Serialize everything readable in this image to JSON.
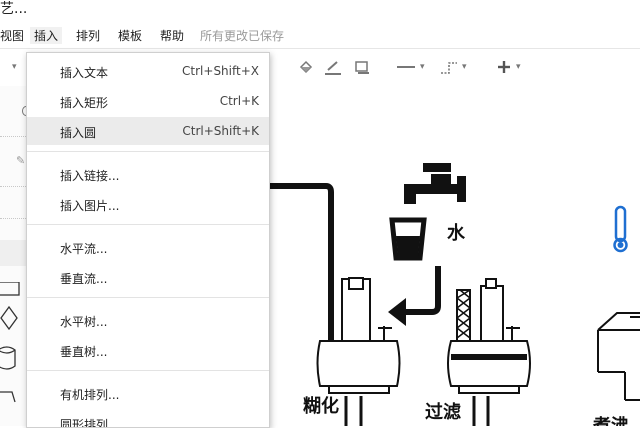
{
  "window": {
    "title": "艺..."
  },
  "menubar": {
    "items": [
      {
        "label": "视图"
      },
      {
        "label": "插入"
      },
      {
        "label": "排列"
      },
      {
        "label": "模板"
      },
      {
        "label": "帮助"
      }
    ],
    "save_status": "所有更改已保存"
  },
  "insert_menu": {
    "items": [
      {
        "label": "插入文本",
        "shortcut": "Ctrl+Shift+X"
      },
      {
        "label": "插入矩形",
        "shortcut": "Ctrl+K"
      },
      {
        "label": "插入圆",
        "shortcut": "Ctrl+Shift+K",
        "highlighted": true
      },
      {
        "label": "插入链接..."
      },
      {
        "label": "插入图片..."
      },
      {
        "label": "水平流..."
      },
      {
        "label": "垂直流..."
      },
      {
        "label": "水平树..."
      },
      {
        "label": "垂直树..."
      },
      {
        "label": "有机排列..."
      },
      {
        "label": "圆形排列"
      }
    ]
  },
  "toolbar": {
    "icons": [
      "chevron-down-icon",
      "fill-color-icon",
      "line-color-icon",
      "shadow-icon",
      "line-style-icon",
      "connector-waypoint-icon",
      "insert-plus-icon"
    ]
  },
  "canvas": {
    "labels": {
      "water": "水",
      "gelatinize": "糊化",
      "filter": "过滤",
      "boil": "煮沸"
    },
    "colors": {
      "stroke": "#111111",
      "thermometer": "#1f6fd1"
    }
  }
}
